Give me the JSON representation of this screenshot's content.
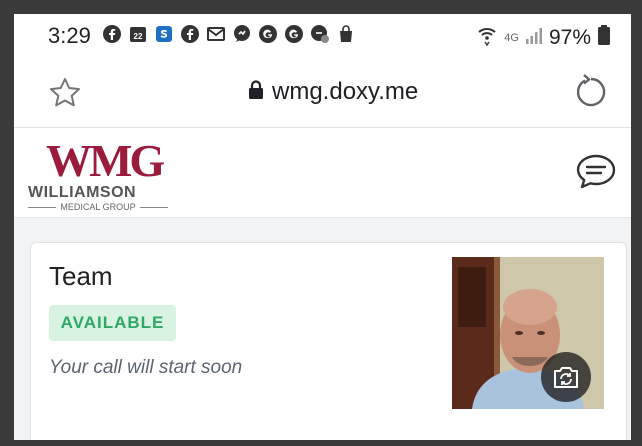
{
  "status_bar": {
    "time": "3:29",
    "calendar_day": "22",
    "network": "4G",
    "battery": "97%"
  },
  "browser": {
    "url": "wmg.doxy.me"
  },
  "site": {
    "logo_mark": "WMG",
    "logo_name": "WILLIAMSON",
    "logo_sub": "MEDICAL GROUP",
    "brand_color": "#9b1b3d"
  },
  "card": {
    "title": "Team",
    "status": "AVAILABLE",
    "message": "Your call will start soon",
    "status_color": "#2ea864"
  }
}
